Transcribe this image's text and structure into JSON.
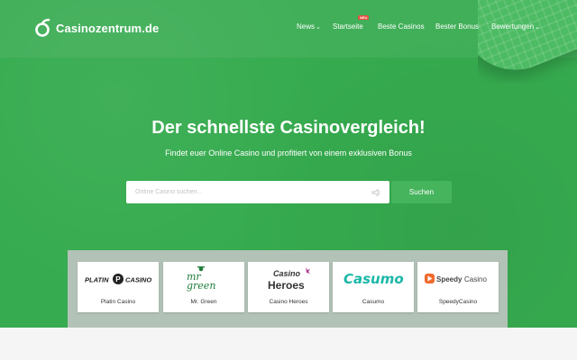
{
  "brand": {
    "name": "Casinozentrum.de",
    "logo_icon": "logo-o-icon"
  },
  "nav": {
    "items": [
      {
        "label": "News",
        "has_dropdown": true
      },
      {
        "label": "Startseite",
        "has_dropdown": false,
        "badge": "NEU"
      },
      {
        "label": "Beste Casinos",
        "has_dropdown": false
      },
      {
        "label": "Bester Bonus",
        "has_dropdown": false
      },
      {
        "label": "Bewertungen",
        "has_dropdown": true
      }
    ],
    "chevron": "⌄"
  },
  "hero": {
    "title": "Der schnellste Casinovergleich!",
    "subtitle": "Findet euer Online Casino und profitiert von einem exklusiven Bonus"
  },
  "search": {
    "placeholder": "Online Casino suchen...",
    "value": "",
    "button_label": "Suchen",
    "mic_icon": "microphone-icon"
  },
  "casinos": [
    {
      "name": "Platin Casino",
      "logo_text": "PLATIN CASINO"
    },
    {
      "name": "Mr. Green",
      "logo_text": "mr green"
    },
    {
      "name": "Casino Heroes",
      "logo_text": "Casino Heroes"
    },
    {
      "name": "Casumo",
      "logo_text": "Casumo"
    },
    {
      "name": "SpeedyCasino",
      "logo_text": "SpeedyCasino"
    }
  ],
  "colors": {
    "hero_green": "#36ab4f",
    "button_green": "#46b45d",
    "badge_red": "#e84a3c",
    "casumo_teal": "#1bb7a7",
    "speedy_orange": "#f06a2e"
  }
}
